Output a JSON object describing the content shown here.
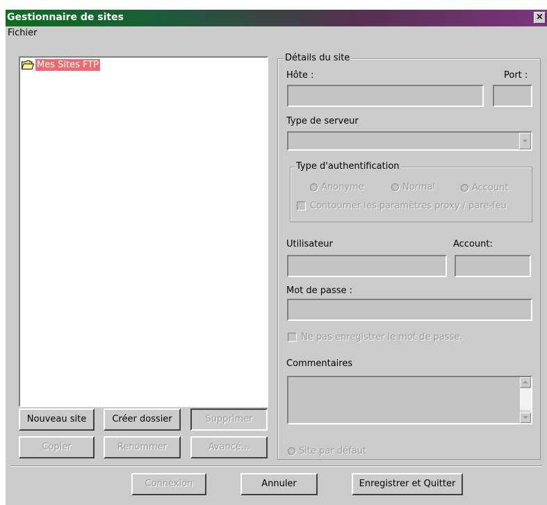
{
  "window": {
    "title": "Gestionnaire de sites",
    "close_glyph": "×"
  },
  "menu": {
    "items": [
      "Fichier"
    ]
  },
  "tree": {
    "root_label": "Mes Sites FTP",
    "root_icon": "folder-icon"
  },
  "buttons": {
    "new_site": "Nouveau site",
    "new_folder": "Créer dossier",
    "delete": "Supprimer",
    "copy": "Copier",
    "rename": "Renommer",
    "advanced": "Avancé...",
    "connect": "Connexion",
    "cancel": "Annuler",
    "save_quit": "Enregistrer et Quitter"
  },
  "details": {
    "legend": "Détails du site",
    "host_label": "Hôte :",
    "port_label": "Port :",
    "server_type_label": "Type de serveur",
    "auth": {
      "legend": "Type d'authentification",
      "anonymous": "Anonyme",
      "normal": "Normal",
      "account": "Account",
      "bypass_proxy": "Contourner les paramètres proxy / pare-feu"
    },
    "user_label": "Utilisateur",
    "account_label": "Account:",
    "password_label": "Mot de passe :",
    "no_save_password": "Ne pas enregistrer le mot de passe.",
    "comments_label": "Commentaires",
    "default_site": "Site par défaut"
  }
}
